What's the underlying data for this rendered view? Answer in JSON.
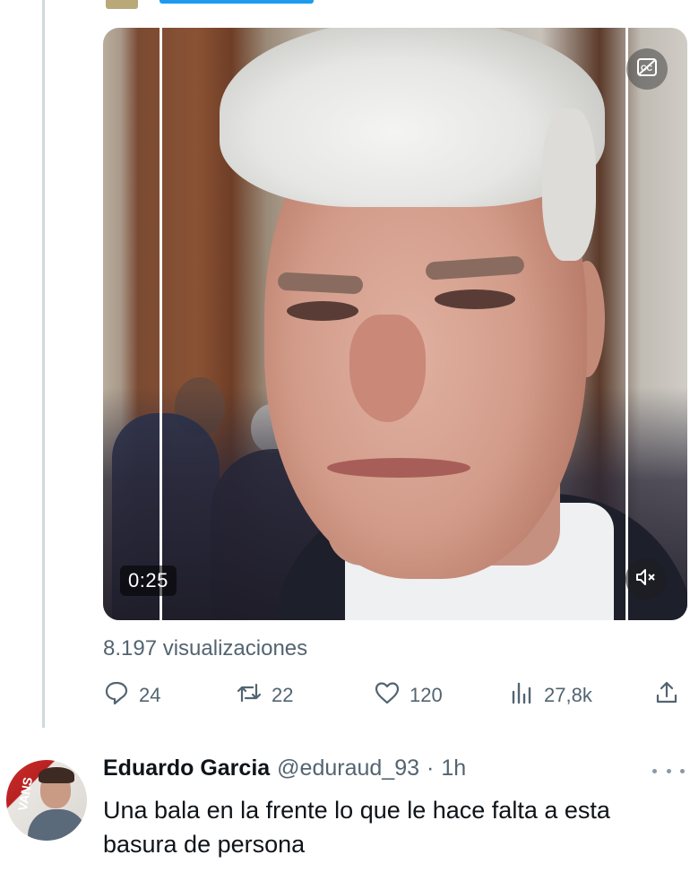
{
  "video": {
    "duration": "0:25",
    "caption_icon": "closed-captions-icon",
    "mute_icon": "speaker-muted-icon"
  },
  "stats": {
    "views_text": "8.197 visualizaciones",
    "replies": "24",
    "retweets": "22",
    "likes": "120",
    "view_count": "27,8k"
  },
  "icons": {
    "reply": "reply-icon",
    "retweet": "retweet-icon",
    "like": "heart-icon",
    "analytics": "analytics-icon",
    "share": "share-icon",
    "more": "more-icon"
  },
  "reply": {
    "name": "Eduardo Garcia",
    "handle": "@eduraud_93",
    "separator": "·",
    "time": "1h",
    "text": "Una bala en la frente lo que le hace falta a esta basura de persona",
    "avatar_text": "VANS"
  },
  "colors": {
    "accent": "#1d9bf0",
    "muted_text": "#536471",
    "primary_text": "#0f1419",
    "thread_line": "#cfd9de"
  }
}
